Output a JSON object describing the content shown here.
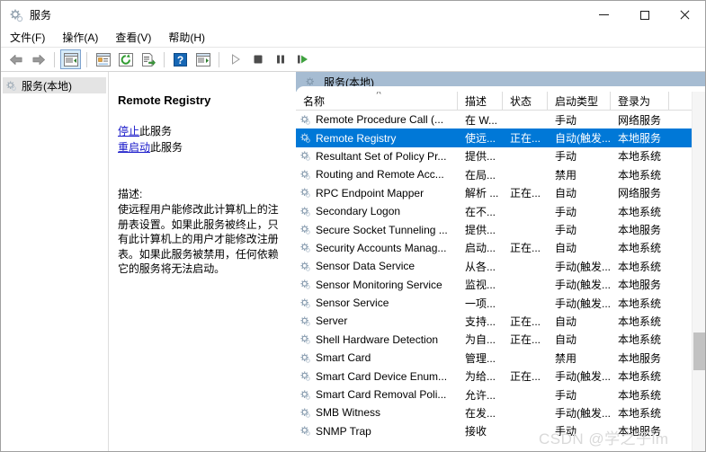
{
  "window": {
    "title": "服务",
    "icon": "gear-icon",
    "minimize_label": "最小化",
    "maximize_label": "最大化",
    "close_label": "关闭"
  },
  "menubar": {
    "items": [
      {
        "label": "文件(F)",
        "name": "menu-file"
      },
      {
        "label": "操作(A)",
        "name": "menu-action"
      },
      {
        "label": "查看(V)",
        "name": "menu-view"
      },
      {
        "label": "帮助(H)",
        "name": "menu-help"
      }
    ]
  },
  "toolbar": {
    "items": [
      {
        "name": "back-icon",
        "glyph": "back"
      },
      {
        "name": "forward-icon",
        "glyph": "forward"
      },
      {
        "name": "show-hide-tree-icon",
        "glyph": "tree"
      },
      {
        "name": "properties-icon",
        "glyph": "props"
      },
      {
        "name": "refresh-icon",
        "glyph": "refresh"
      },
      {
        "name": "export-list-icon",
        "glyph": "export"
      },
      {
        "name": "help-icon",
        "glyph": "help"
      },
      {
        "name": "show-action-pane-icon",
        "glyph": "actionpane"
      },
      {
        "name": "start-service-icon",
        "glyph": "play"
      },
      {
        "name": "stop-service-icon",
        "glyph": "stop"
      },
      {
        "name": "pause-service-icon",
        "glyph": "pause"
      },
      {
        "name": "restart-service-icon",
        "glyph": "restart"
      }
    ]
  },
  "tree": {
    "root_label": "服务(本地)"
  },
  "tab": {
    "label": "服务(本地)"
  },
  "detail": {
    "service_title": "Remote Registry",
    "links": [
      {
        "action": "停止",
        "suffix": "此服务",
        "name": "stop-service-link"
      },
      {
        "action": "重启动",
        "suffix": "此服务",
        "name": "restart-service-link"
      }
    ],
    "description_label": "描述:",
    "description_body": "使远程用户能修改此计算机上的注册表设置。如果此服务被终止，只有此计算机上的用户才能修改注册表。如果此服务被禁用，任何依赖它的服务将无法启动。"
  },
  "list": {
    "columns": [
      {
        "label": "名称",
        "key": "name",
        "sorted": true
      },
      {
        "label": "描述",
        "key": "desc",
        "sorted": false
      },
      {
        "label": "状态",
        "key": "state",
        "sorted": false
      },
      {
        "label": "启动类型",
        "key": "startup",
        "sorted": false
      },
      {
        "label": "登录为",
        "key": "logon",
        "sorted": false
      }
    ],
    "rows": [
      {
        "name": "Remote Procedure Call (...",
        "desc": "在 W...",
        "state": "",
        "startup": "手动",
        "logon": "网络服务",
        "selected": false
      },
      {
        "name": "Remote Registry",
        "desc": "使远...",
        "state": "正在...",
        "startup": "自动(触发...",
        "logon": "本地服务",
        "selected": true
      },
      {
        "name": "Resultant Set of Policy Pr...",
        "desc": "提供...",
        "state": "",
        "startup": "手动",
        "logon": "本地系统",
        "selected": false
      },
      {
        "name": "Routing and Remote Acc...",
        "desc": "在局...",
        "state": "",
        "startup": "禁用",
        "logon": "本地系统",
        "selected": false
      },
      {
        "name": "RPC Endpoint Mapper",
        "desc": "解析 ...",
        "state": "正在...",
        "startup": "自动",
        "logon": "网络服务",
        "selected": false
      },
      {
        "name": "Secondary Logon",
        "desc": "在不...",
        "state": "",
        "startup": "手动",
        "logon": "本地系统",
        "selected": false
      },
      {
        "name": "Secure Socket Tunneling ...",
        "desc": "提供...",
        "state": "",
        "startup": "手动",
        "logon": "本地服务",
        "selected": false
      },
      {
        "name": "Security Accounts Manag...",
        "desc": "启动...",
        "state": "正在...",
        "startup": "自动",
        "logon": "本地系统",
        "selected": false
      },
      {
        "name": "Sensor Data Service",
        "desc": "从各...",
        "state": "",
        "startup": "手动(触发...",
        "logon": "本地系统",
        "selected": false
      },
      {
        "name": "Sensor Monitoring Service",
        "desc": "监视...",
        "state": "",
        "startup": "手动(触发...",
        "logon": "本地服务",
        "selected": false
      },
      {
        "name": "Sensor Service",
        "desc": "一项...",
        "state": "",
        "startup": "手动(触发...",
        "logon": "本地系统",
        "selected": false
      },
      {
        "name": "Server",
        "desc": "支持...",
        "state": "正在...",
        "startup": "自动",
        "logon": "本地系统",
        "selected": false
      },
      {
        "name": "Shell Hardware Detection",
        "desc": "为自...",
        "state": "正在...",
        "startup": "自动",
        "logon": "本地系统",
        "selected": false
      },
      {
        "name": "Smart Card",
        "desc": "管理...",
        "state": "",
        "startup": "禁用",
        "logon": "本地服务",
        "selected": false
      },
      {
        "name": "Smart Card Device Enum...",
        "desc": "为给...",
        "state": "正在...",
        "startup": "手动(触发...",
        "logon": "本地系统",
        "selected": false
      },
      {
        "name": "Smart Card Removal Poli...",
        "desc": "允许...",
        "state": "",
        "startup": "手动",
        "logon": "本地系统",
        "selected": false
      },
      {
        "name": "SMB Witness",
        "desc": "在发...",
        "state": "",
        "startup": "手动(触发...",
        "logon": "本地系统",
        "selected": false
      },
      {
        "name": "SNMP Trap",
        "desc": "接收",
        "state": "",
        "startup": "手动",
        "logon": "本地服务",
        "selected": false
      }
    ]
  },
  "watermark": {
    "text": "CSDN @学之子lm"
  },
  "colors": {
    "selection": "#0078d7",
    "tab_bar": "#a6bcd2",
    "link": "#1717c9",
    "watermark": "#d9d9d9"
  }
}
